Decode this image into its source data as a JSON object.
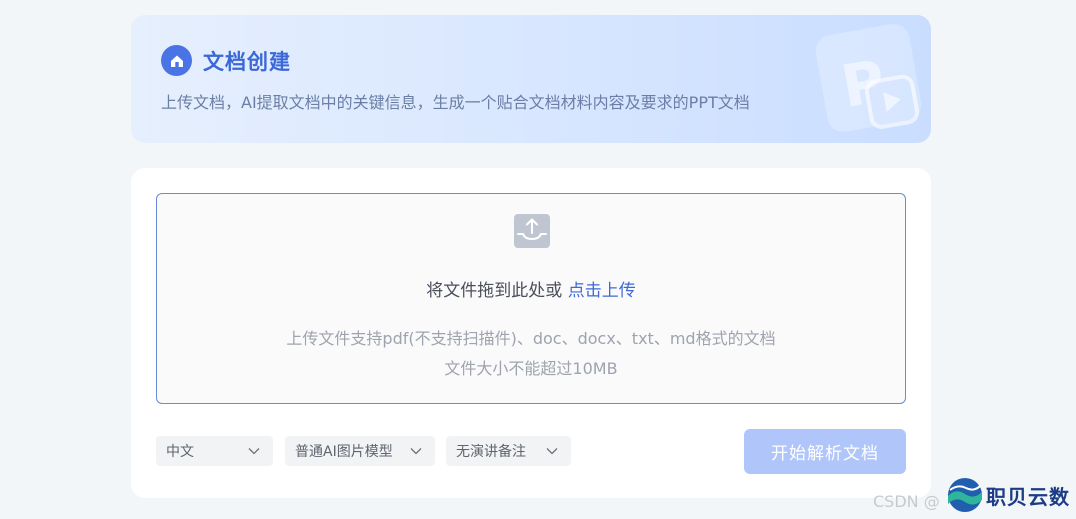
{
  "header": {
    "icon": "home-icon",
    "title": "文档创建",
    "description": "上传文档，AI提取文档中的关键信息，生成一个贴合文档材料内容及要求的PPT文档"
  },
  "upload": {
    "icon": "upload-icon",
    "prompt": "将文件拖到此处或 ",
    "link_label": "点击上传",
    "support_text": "上传文件支持pdf(不支持扫描件)、doc、docx、txt、md格式的文档",
    "size_text": "文件大小不能超过10MB"
  },
  "options": {
    "language": "中文",
    "image_model": "普通AI图片模型",
    "speaker_notes": "无演讲备注"
  },
  "actions": {
    "start_label": "开始解析文档"
  },
  "watermark": {
    "csdn": "CSDN @",
    "brand": "职贝云数"
  },
  "colors": {
    "accent": "#3d6ad6",
    "button_disabled": "#b0c6fb",
    "banner_start": "#e6effd",
    "banner_end": "#c9ddff"
  }
}
